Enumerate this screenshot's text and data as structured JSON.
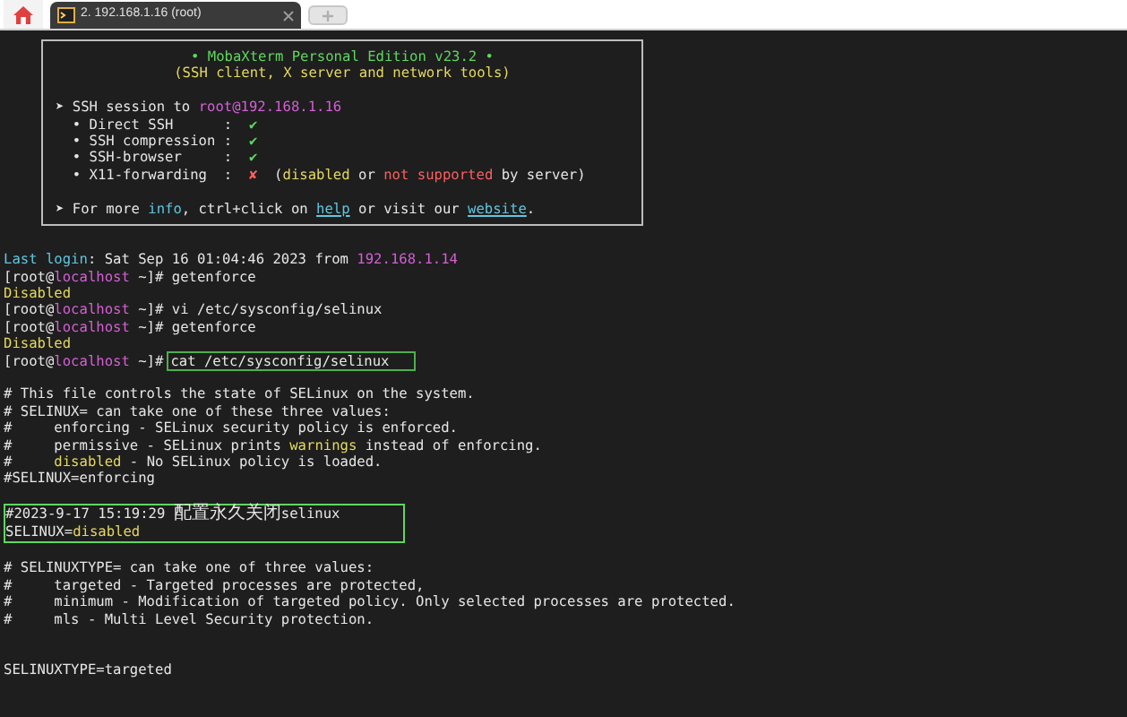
{
  "tabs": [
    {
      "label": "2. 192.168.1.16 (root)",
      "selected": true
    }
  ],
  "banner": {
    "lines": [
      {
        "centered": true,
        "segments": [
          {
            "kind": "heading",
            "text": "• MobaXterm Personal Edition v23.2 •"
          }
        ]
      },
      {
        "centered": true,
        "segments": [
          {
            "kind": "subheading",
            "text": "(SSH client, X server and network tools)"
          }
        ]
      },
      {
        "kind": "blank"
      },
      {
        "segments": [
          {
            "kind": "plain",
            "text": "➤ SSH session to "
          },
          {
            "kind": "host",
            "text": "root@192.168.1.16"
          }
        ]
      },
      {
        "segments": [
          {
            "kind": "plain",
            "text": "  • Direct SSH      :  "
          },
          {
            "kind": "ok",
            "text": "✔"
          }
        ]
      },
      {
        "segments": [
          {
            "kind": "plain",
            "text": "  • SSH compression :  "
          },
          {
            "kind": "ok",
            "text": "✔"
          }
        ]
      },
      {
        "segments": [
          {
            "kind": "plain",
            "text": "  • SSH-browser     :  "
          },
          {
            "kind": "ok",
            "text": "✔"
          }
        ]
      },
      {
        "segments": [
          {
            "kind": "plain",
            "text": "  • X11-forwarding  :  "
          },
          {
            "kind": "error",
            "text": "✘"
          },
          {
            "kind": "plain",
            "text": "  ("
          },
          {
            "kind": "warn",
            "text": "disabled"
          },
          {
            "kind": "plain",
            "text": " or "
          },
          {
            "kind": "error",
            "text": "not supported"
          },
          {
            "kind": "plain",
            "text": " by server)"
          }
        ]
      },
      {
        "kind": "blank"
      },
      {
        "segments": [
          {
            "kind": "plain",
            "text": "➤ For more "
          },
          {
            "kind": "info",
            "text": "info"
          },
          {
            "kind": "plain",
            "text": ", ctrl+click on "
          },
          {
            "kind": "link",
            "text": "help"
          },
          {
            "kind": "plain",
            "text": " or visit our "
          },
          {
            "kind": "link",
            "text": "website"
          },
          {
            "kind": "plain",
            "text": "."
          }
        ]
      }
    ]
  },
  "terminal": [
    {
      "kind": "blank"
    },
    {
      "segments": [
        {
          "kind": "info",
          "text": "Last login"
        },
        {
          "kind": "plain",
          "text": ": Sat Sep 16 01:04:46 2023 from "
        },
        {
          "kind": "host",
          "text": "192.168.1.14"
        }
      ]
    },
    {
      "segments": [
        {
          "kind": "plain",
          "text": "[root@"
        },
        {
          "kind": "host",
          "text": "localhost"
        },
        {
          "kind": "plain",
          "text": " ~]# getenforce"
        }
      ]
    },
    {
      "segments": [
        {
          "kind": "warn",
          "text": "Disabled"
        }
      ]
    },
    {
      "segments": [
        {
          "kind": "plain",
          "text": "[root@"
        },
        {
          "kind": "host",
          "text": "localhost"
        },
        {
          "kind": "plain",
          "text": " ~]# vi /etc/sysconfig/selinux"
        }
      ]
    },
    {
      "segments": [
        {
          "kind": "plain",
          "text": "[root@"
        },
        {
          "kind": "host",
          "text": "localhost"
        },
        {
          "kind": "plain",
          "text": " ~]# getenforce"
        }
      ]
    },
    {
      "segments": [
        {
          "kind": "warn",
          "text": "Disabled"
        }
      ]
    },
    {
      "segments": [
        {
          "kind": "plain",
          "text": "[root@"
        },
        {
          "kind": "host",
          "text": "localhost"
        },
        {
          "kind": "plain",
          "text": " ~]#"
        },
        {
          "kind": "boxed",
          "text": "cat /etc/sysconfig/selinux"
        }
      ]
    },
    {
      "kind": "blank"
    },
    {
      "segments": [
        {
          "kind": "plain",
          "text": "# This file controls the state of SELinux on the system."
        }
      ]
    },
    {
      "segments": [
        {
          "kind": "plain",
          "text": "# SELINUX= can take one of these three values:"
        }
      ]
    },
    {
      "segments": [
        {
          "kind": "plain",
          "text": "#     enforcing - SELinux security policy is enforced."
        }
      ]
    },
    {
      "segments": [
        {
          "kind": "plain",
          "text": "#     permissive - SELinux prints "
        },
        {
          "kind": "warn",
          "text": "warnings"
        },
        {
          "kind": "plain",
          "text": " instead of enforcing."
        }
      ]
    },
    {
      "segments": [
        {
          "kind": "plain",
          "text": "#     "
        },
        {
          "kind": "warn",
          "text": "disabled"
        },
        {
          "kind": "plain",
          "text": " - No SELinux policy is loaded."
        }
      ]
    },
    {
      "segments": [
        {
          "kind": "plain",
          "text": "#SELINUX=enforcing"
        }
      ]
    },
    {
      "kind": "blank"
    },
    {
      "kind": "highlight",
      "lines": [
        {
          "segments": [
            {
              "kind": "plain",
              "text": "#2023-9-17 15:19:29 "
            },
            {
              "kind": "cjk",
              "text": "配置永久关闭"
            },
            {
              "kind": "plain",
              "text": "selinux"
            }
          ]
        },
        {
          "segments": [
            {
              "kind": "plain",
              "text": "SELINUX="
            },
            {
              "kind": "warn",
              "text": "disabled"
            }
          ]
        }
      ]
    },
    {
      "kind": "blank"
    },
    {
      "segments": [
        {
          "kind": "plain",
          "text": "# SELINUXTYPE= can take one of three values:"
        }
      ]
    },
    {
      "segments": [
        {
          "kind": "plain",
          "text": "#     targeted - Targeted processes are protected,"
        }
      ]
    },
    {
      "segments": [
        {
          "kind": "plain",
          "text": "#     minimum - Modification of targeted policy. Only selected processes are protected."
        }
      ]
    },
    {
      "segments": [
        {
          "kind": "plain",
          "text": "#     mls - Multi Level Security protection."
        }
      ]
    },
    {
      "kind": "blank"
    },
    {
      "kind": "blank"
    },
    {
      "segments": [
        {
          "kind": "plain",
          "text": "SELINUXTYPE=targeted"
        }
      ]
    }
  ]
}
